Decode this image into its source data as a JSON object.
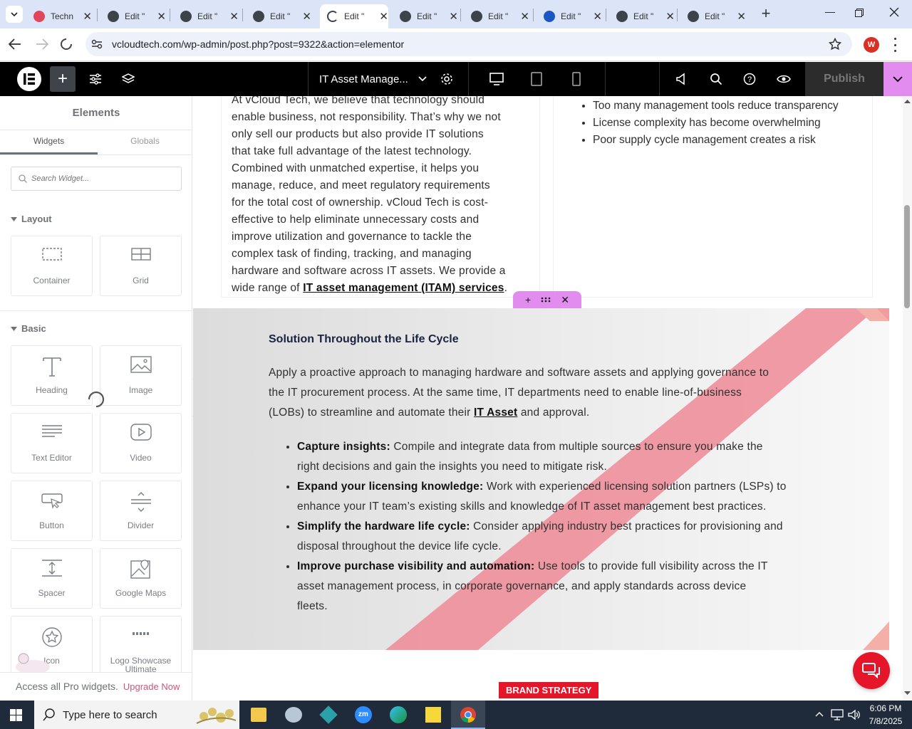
{
  "browser": {
    "tabs": [
      {
        "title": "Techn",
        "icon": "brand-icon",
        "color": "#e2445c"
      },
      {
        "title": "Edit \"",
        "icon": "wordpress-icon",
        "color": "#3c434a"
      },
      {
        "title": "Edit \"",
        "icon": "wordpress-icon",
        "color": "#3c434a"
      },
      {
        "title": "Edit \"",
        "icon": "wordpress-icon",
        "color": "#3c434a"
      },
      {
        "title": "Edit \"",
        "icon": "loading-icon",
        "color": "#3c434a"
      },
      {
        "title": "Edit \"",
        "icon": "wordpress-icon",
        "color": "#3c434a"
      },
      {
        "title": "Edit \"",
        "icon": "wordpress-icon",
        "color": "#3c434a"
      },
      {
        "title": "Edit \"",
        "icon": "wordpress-icon",
        "color": "#1a56c4"
      },
      {
        "title": "Edit \"",
        "icon": "wordpress-icon",
        "color": "#3c434a"
      },
      {
        "title": "Edit \"",
        "icon": "wordpress-icon",
        "color": "#3c434a"
      }
    ],
    "active_tab": 4,
    "url": "vcloudtech.com/wp-admin/post.php?post=9322&action=elementor",
    "profile_initial": "W"
  },
  "editor": {
    "page_title": "IT Asset Manage...",
    "publish_label": "Publish",
    "accent": "#e28cf0"
  },
  "sidebar": {
    "heading": "Elements",
    "tabs": [
      "Widgets",
      "Globals"
    ],
    "search_placeholder": "Search Widget...",
    "sections": [
      {
        "title": "Layout",
        "widgets": [
          "Container",
          "Grid"
        ]
      },
      {
        "title": "Basic",
        "widgets": [
          "Heading",
          "Image",
          "Text Editor",
          "Video",
          "Button",
          "Divider",
          "Spacer",
          "Google Maps",
          "Icon",
          "Logo Showcase Ultimate"
        ]
      }
    ],
    "footer_text": "Access all Pro widgets.",
    "footer_link": "Upgrade Now"
  },
  "canvas": {
    "intro_lines": [
      "At vCloud Tech, we believe that technology should",
      "enable business, not responsibility. That’s why we not",
      "only sell our products but also provide IT solutions",
      "that take full advantage of the latest technology.",
      "Combined with unmatched expertise, it helps you",
      "manage, reduce, and meet regulatory requirements",
      "for the total cost of ownership. vCloud Tech is cost-",
      "effective to help eliminate unnecessary costs and",
      "improve utilization and governance to tackle the",
      "complex task of finding, tracking, and managing",
      "hardware and software across IT assets. We provide a"
    ],
    "intro_last_prefix": "wide range of",
    "intro_link": "IT asset management (ITAM) services",
    "intro_suffix": ".",
    "right_list": [
      "Too many management tools reduce transparency",
      "License complexity has become overwhelming",
      "Poor supply cycle management creates a risk"
    ],
    "section_heading": "Solution Throughout the Life Cycle",
    "section_lines": [
      "Apply a proactive approach to managing hardware and software assets and applying governance to",
      "the IT procurement process. At the same time, IT departments need to enable line-of-business"
    ],
    "section_last_prefix": "(LOBs) to streamline and automate their",
    "section_link": "IT Asset",
    "section_last_suffix": "and approval.",
    "bullets": [
      {
        "bold": "Capture insights:",
        "lines": [
          "Compile and integrate data from multiple sources to ensure you make the",
          "right decisions and gain the insights you need to mitigate risk."
        ]
      },
      {
        "bold": "Expand your licensing knowledge:",
        "lines": [
          "Work with experienced licensing solution partners (LSPs) to",
          "enhance your IT team’s existing skills and knowledge of IT asset management best practices."
        ]
      },
      {
        "bold": "Simplify the hardware life cycle:",
        "lines": [
          "Consider applying industry best practices for provisioning and",
          "disposal throughout the device life cycle."
        ]
      },
      {
        "bold": "Improve purchase visibility and automation:",
        "lines": [
          "Use tools to provide full visibility across the IT",
          "asset management process, in corporate governance, and apply standards across device",
          "fleets."
        ]
      }
    ],
    "brand_label": "BRAND STRATEGY",
    "brand_color": "#e5152a"
  },
  "taskbar": {
    "search_placeholder": "Type here to search",
    "time": "6:06 PM",
    "date": "7/8/2025"
  }
}
